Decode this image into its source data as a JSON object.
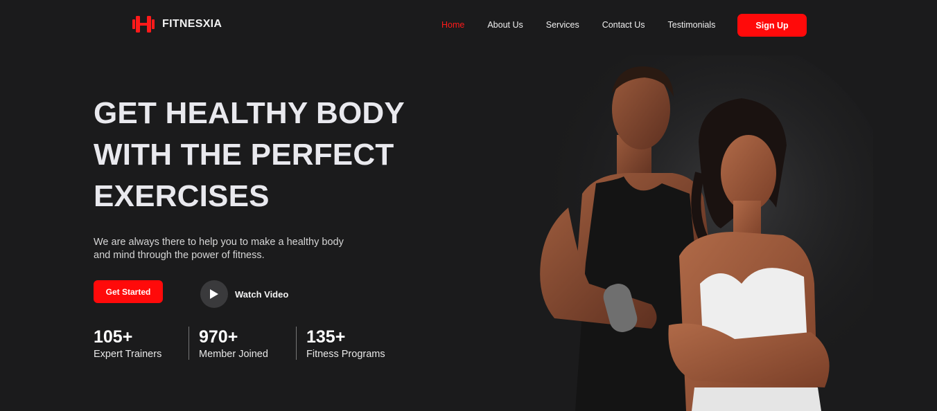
{
  "brand": {
    "name": "FITNESXIA",
    "icon": "dumbbell-icon",
    "accent": "#ff0a0a"
  },
  "nav": {
    "items": [
      {
        "label": "Home",
        "active": true
      },
      {
        "label": "About Us"
      },
      {
        "label": "Services"
      },
      {
        "label": "Contact Us"
      },
      {
        "label": "Testimonials"
      }
    ],
    "signup_label": "Sign Up"
  },
  "hero": {
    "title_lines": [
      "GET HEALTHY BODY",
      "WITH THE PERFECT",
      "EXERCISES"
    ],
    "subtitle_lines": [
      "We are always there to help you to make a healthy body",
      "and mind through the power of fitness."
    ],
    "cta_label": "Get Started",
    "watch_label": "Watch Video",
    "watch_icon": "play-icon"
  },
  "stats": [
    {
      "value": "105+",
      "label": "Expert Trainers"
    },
    {
      "value": "970+",
      "label": "Member Joined"
    },
    {
      "value": "135+",
      "label": "Fitness Programs"
    }
  ],
  "colors": {
    "background": "#1b1b1c",
    "accent": "#ff0a0a",
    "title": "#e9e9ee"
  }
}
